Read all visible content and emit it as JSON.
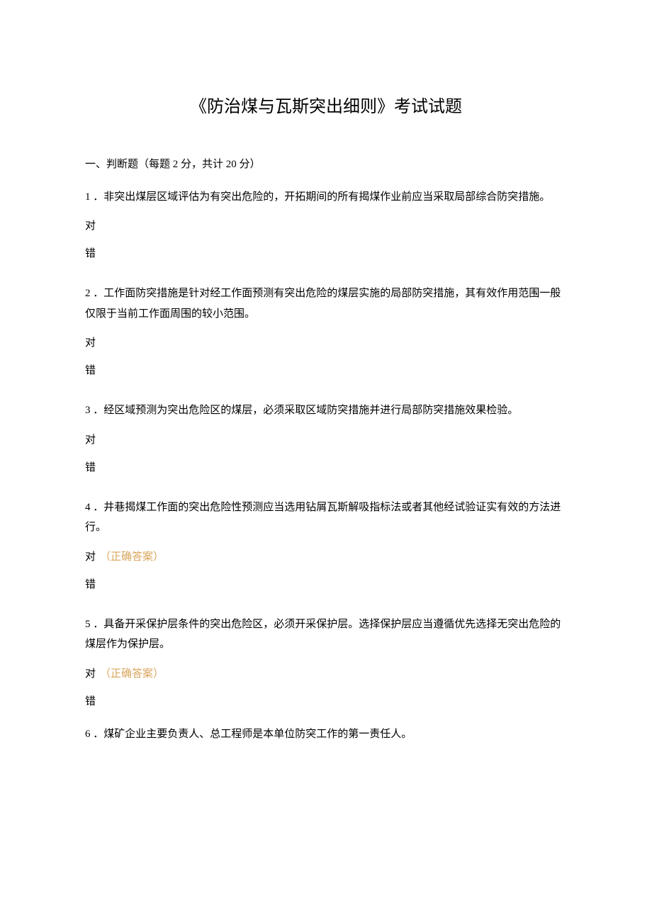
{
  "title": "《防治煤与瓦斯突出细则》考试试题",
  "section_header": "一、判断题（每题 2 分，共计 20 分）",
  "correct_label": "（正确答案）",
  "questions": {
    "q1": {
      "text": "1 ．非突出煤层区域评估为有突出危险的，开拓期间的所有揭煤作业前应当采取局部综合防突措施。",
      "opt_true": "对",
      "opt_false": "错"
    },
    "q2": {
      "text": "2 ．工作面防突措施是针对经工作面预测有突出危险的煤层实施的局部防突措施，其有效作用范围一般仅限于当前工作面周围的较小范围。",
      "opt_true": "对",
      "opt_false": "错"
    },
    "q3": {
      "text": "3 ．经区域预测为突出危险区的煤层，必须采取区域防突措施并进行局部防突措施效果检验。",
      "opt_true": "对",
      "opt_false": "错"
    },
    "q4": {
      "text": "4 ．井巷揭煤工作面的突出危险性预测应当选用钻屑瓦斯解吸指标法或者其他经试验证实有效的方法进行。",
      "opt_true": "对",
      "opt_false": "错"
    },
    "q5": {
      "text": "5 ．具备开采保护层条件的突出危险区，必须开采保护层。选择保护层应当遵循优先选择无突出危险的煤层作为保护层。",
      "opt_true": "对",
      "opt_false": "错"
    },
    "q6": {
      "text": "6 ．煤矿企业主要负责人、总工程师是本单位防突工作的第一责任人。"
    }
  }
}
